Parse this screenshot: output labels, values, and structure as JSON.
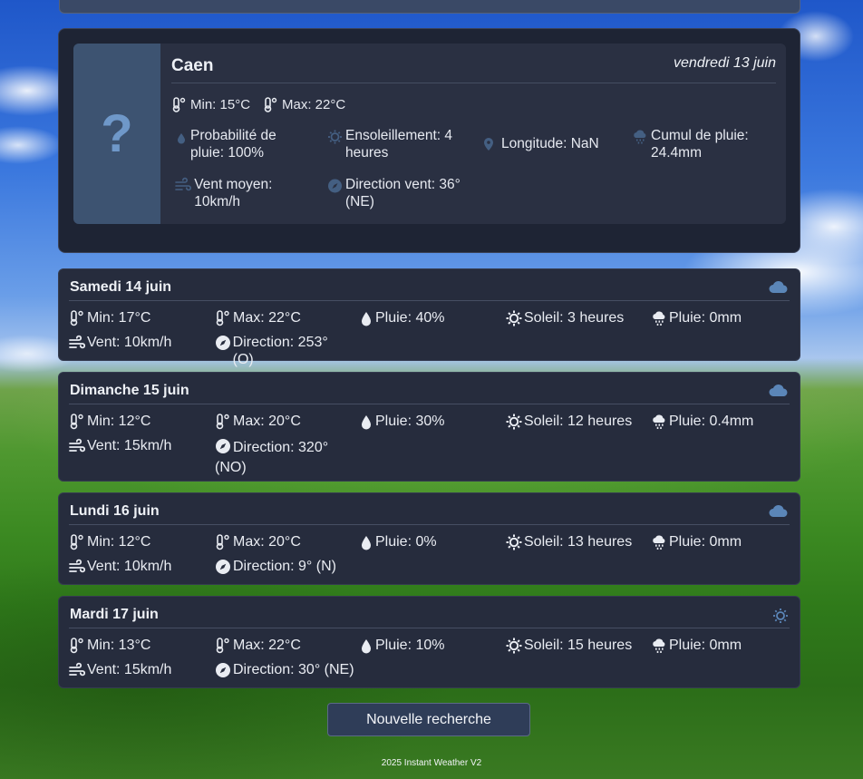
{
  "current": {
    "city": "Caen",
    "date": "vendredi 13 juin",
    "condition_icon": "question-icon",
    "condition_glyph": "?",
    "min": "Min: 15°C",
    "max": "Max: 22°C",
    "rain_probability": "Probabilité de pluie: 100%",
    "sunshine": "Ensoleillement: 4 heures",
    "longitude": "Longitude: NaN",
    "rain_total": "Cumul de pluie: 24.4mm",
    "wind": "Vent moyen: 10km/h",
    "wind_direction": "Direction vent: 36° (NE)"
  },
  "days": [
    {
      "title": "Samedi 14 juin",
      "condition_icon": "cloud-icon",
      "min": "Min: 17°C",
      "max": "Max: 22°C",
      "rain_prob": "Pluie: 40%",
      "sun": "Soleil: 3 heures",
      "rain": "Pluie: 0mm",
      "wind": "Vent: 10km/h",
      "direction": "Direction: 253° (O)"
    },
    {
      "title": "Dimanche 15 juin",
      "condition_icon": "cloud-icon",
      "min": "Min: 12°C",
      "max": "Max: 20°C",
      "rain_prob": "Pluie: 30%",
      "sun": "Soleil: 12 heures",
      "rain": "Pluie: 0.4mm",
      "wind": "Vent: 15km/h",
      "direction": "Direction: 320° (NO)"
    },
    {
      "title": "Lundi 16 juin",
      "condition_icon": "cloud-icon",
      "min": "Min: 12°C",
      "max": "Max: 20°C",
      "rain_prob": "Pluie: 0%",
      "sun": "Soleil: 13 heures",
      "rain": "Pluie: 0mm",
      "wind": "Vent: 10km/h",
      "direction": "Direction: 9° (N)"
    },
    {
      "title": "Mardi 17 juin",
      "condition_icon": "sun-icon",
      "min": "Min: 13°C",
      "max": "Max: 22°C",
      "rain_prob": "Pluie: 10%",
      "sun": "Soleil: 15 heures",
      "rain": "Pluie: 0mm",
      "wind": "Vent: 15km/h",
      "direction": "Direction: 30° (NE)"
    }
  ],
  "new_search_label": "Nouvelle recherche",
  "footer": "2025 Instant Weather V2",
  "colors": {
    "panel": "#1e2434",
    "card": "#262c3d",
    "icon_blue": "#5b86b8",
    "button": "#2f3d58"
  }
}
